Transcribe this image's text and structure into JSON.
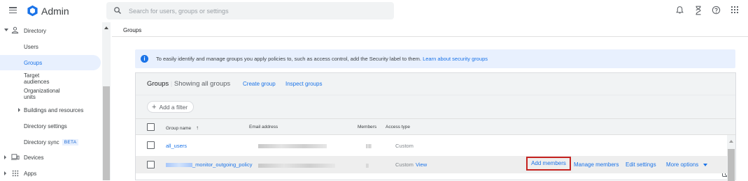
{
  "app": {
    "title": "Admin"
  },
  "search": {
    "placeholder": "Search for users, groups or settings"
  },
  "sidebar": {
    "items": [
      {
        "label": "Directory"
      },
      {
        "label": "Users"
      },
      {
        "label": "Groups"
      },
      {
        "label": "Target audiences"
      },
      {
        "label": "Organizational units"
      },
      {
        "label": "Buildings and resources"
      },
      {
        "label": "Directory settings"
      },
      {
        "label": "Directory sync"
      },
      {
        "label": "Devices"
      },
      {
        "label": "Apps"
      }
    ],
    "beta_badge": "BETA"
  },
  "breadcrumb": "Groups",
  "banner": {
    "text": "To easily identify and manage groups you apply policies to, such as access control, add the Security label to them.",
    "link": "Learn about security groups"
  },
  "groups_card": {
    "title": "Groups",
    "separator": "|",
    "subtitle": "Showing all groups",
    "create_group": "Create group",
    "inspect_groups": "Inspect groups",
    "add_filter": "Add a filter",
    "columns": {
      "group_name": "Group name",
      "email": "Email address",
      "members": "Members",
      "access_type": "Access type"
    },
    "rows": [
      {
        "name": "all_users",
        "access_type": "Custom",
        "view": ""
      },
      {
        "name": "_monitor_outgoing_policy",
        "access_type": "Custom",
        "view": "View"
      }
    ],
    "row_actions": {
      "add_members": "Add members",
      "manage_members": "Manage members",
      "edit_settings": "Edit settings",
      "more_options": "More options"
    }
  },
  "colors": {
    "accent": "#1a73e8",
    "highlight_border": "#c5221f",
    "selected_bg": "#e8f0fe"
  }
}
